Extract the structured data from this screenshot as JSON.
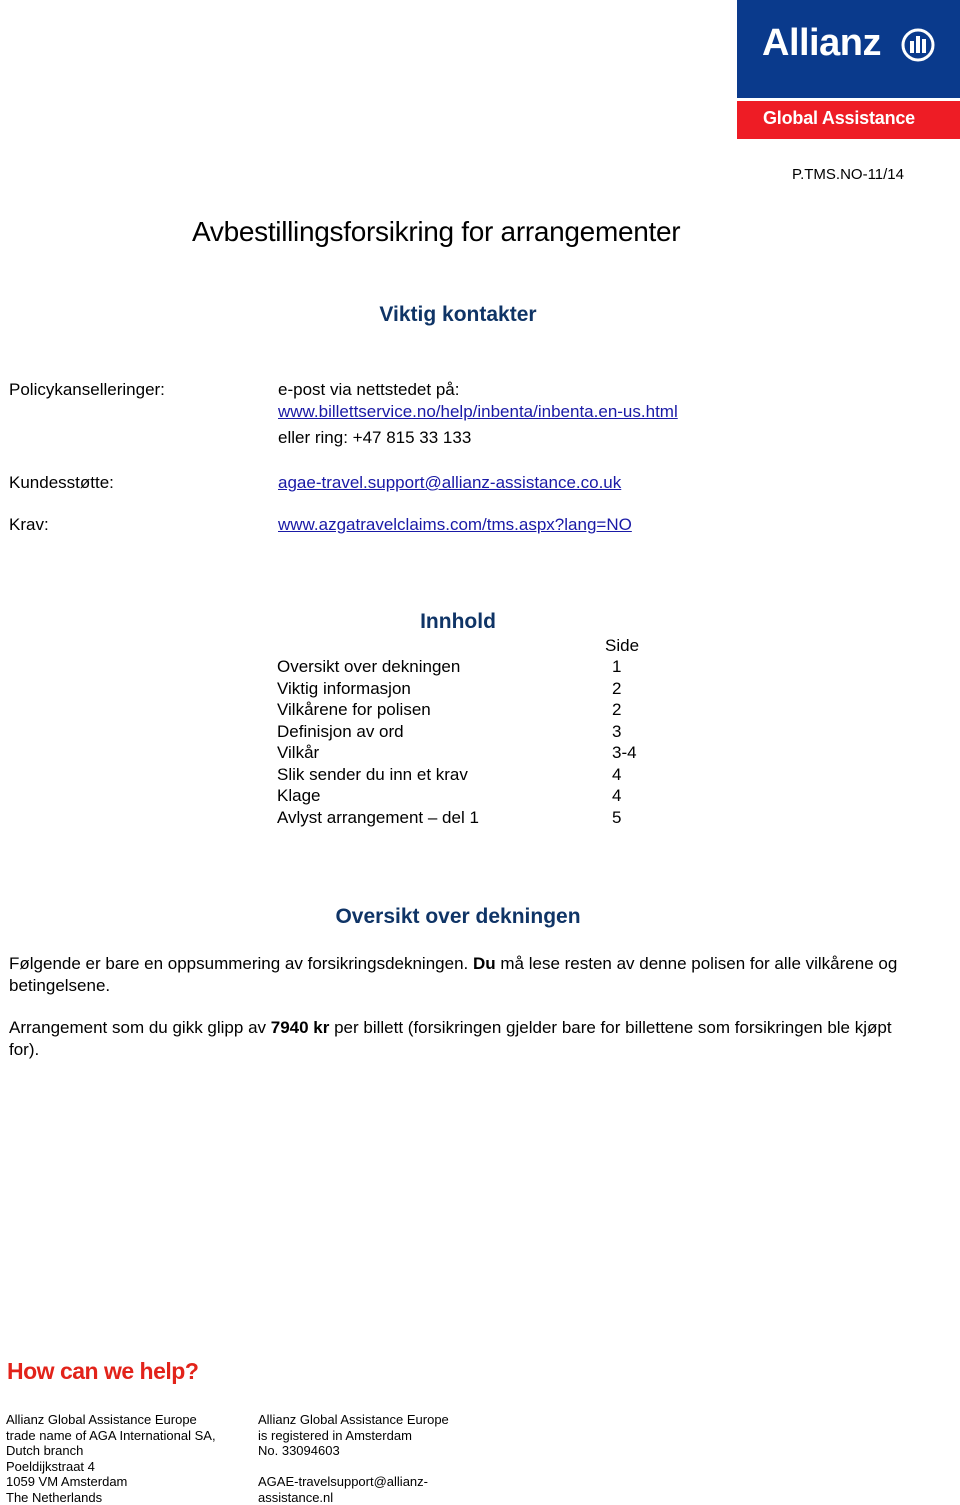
{
  "logo": {
    "brand": "Allianz",
    "subtitle": "Global Assistance",
    "emblem_icon": "allianz-eagle-emblem-icon",
    "colors": {
      "blue": "#0a3a8c",
      "red": "#ee1c25"
    }
  },
  "doc_ref": "P.TMS.NO-11/14",
  "title": "Avbestillingsforsikring for arrangementer",
  "contacts": {
    "heading": "Viktig kontakter",
    "items": [
      {
        "label": "Policykanselleringer:",
        "line1": "e-post via nettstedet på:",
        "link": "www.billettservice.no/help/inbenta/inbenta.en-us.html",
        "line3": "eller ring: +47 815 33 133"
      },
      {
        "label": "Kundesstøtte:",
        "link": "agae-travel.support@allianz-assistance.co.uk"
      },
      {
        "label": "Krav:",
        "link": "www.azgatravelclaims.com/tms.aspx?lang=NO"
      }
    ]
  },
  "toc": {
    "heading": "Innhold",
    "page_header": "Side",
    "rows": [
      {
        "label": "Oversikt over dekningen",
        "page": "1"
      },
      {
        "label": "Viktig informasjon",
        "page": "2"
      },
      {
        "label": "Vilkårene for polisen",
        "page": "2"
      },
      {
        "label": "Definisjon av ord",
        "page": "3"
      },
      {
        "label": "Vilkår",
        "page": "3-4"
      },
      {
        "label": "Slik sender du inn et krav",
        "page": "4"
      },
      {
        "label": "Klage",
        "page": "4"
      },
      {
        "label": "Avlyst arrangement – del 1",
        "page": "5"
      }
    ]
  },
  "overview": {
    "heading": "Oversikt over dekningen",
    "p1_a": "Følgende er bare en oppsummering av forsikringsdekningen. ",
    "p1_bold": "Du",
    "p1_b": " må lese resten av denne polisen for alle vilkårene og betingelsene.",
    "p2_a": "Arrangement som du gikk glipp av ",
    "p2_bold": "7940 kr",
    "p2_b": " per billett (forsikringen gjelder bare for billettene som forsikringen ble kjøpt for)."
  },
  "footer": {
    "help_heading": "How can we help?",
    "left": [
      "Allianz Global Assistance Europe",
      "trade name of AGA International SA,",
      "Dutch branch",
      "Poeldijkstraat 4",
      "1059 VM Amsterdam",
      "The Netherlands"
    ],
    "right": [
      "Allianz Global Assistance Europe",
      "is registered in Amsterdam",
      "No. 33094603"
    ],
    "email_line1": "AGAE-travelsupport@allianz-",
    "email_line2": "assistance.nl"
  }
}
